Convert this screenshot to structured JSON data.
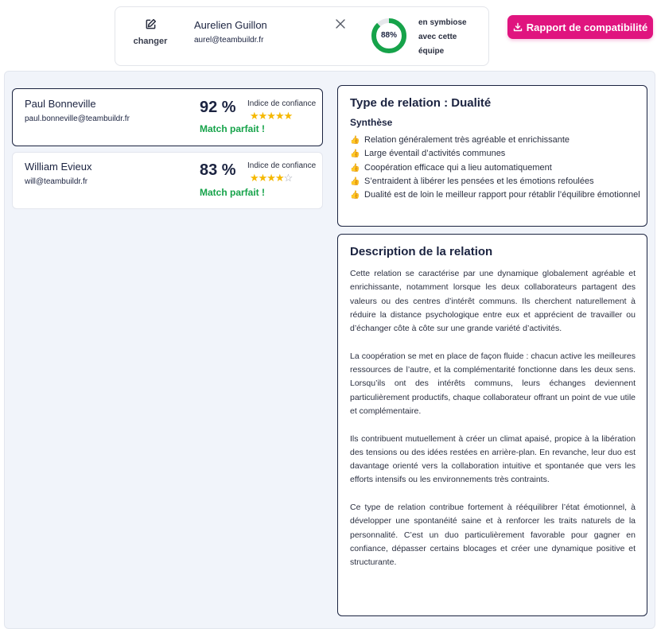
{
  "header": {
    "change_label": "changer",
    "person": {
      "name": "Aurelien Guillon",
      "email": "aurel@teambuildr.fr"
    },
    "gauge": {
      "value": 0.88,
      "label": "88%",
      "color": "#16a34a",
      "track_color": "#e5e7eb"
    },
    "symbiose_text": "en symbiose avec cette équipe",
    "report_button": {
      "label": "Rapport de compatibilité",
      "icon": "download-icon",
      "color": "#e0147f"
    }
  },
  "matches": [
    {
      "name": "Paul Bonneville",
      "email": "paul.bonneville@teambuildr.fr",
      "percent": "92 %",
      "confidence_label": "Indice de confiance",
      "stars": 5,
      "stars_text": "★★★★★",
      "match_label": "Match parfait !",
      "selected": true
    },
    {
      "name": "William Evieux",
      "email": "will@teambuildr.fr",
      "percent": "83 %",
      "confidence_label": "Indice de confiance",
      "stars": 4,
      "stars_on_text": "★★★★",
      "stars_off_text": "☆",
      "match_label": "Match parfait !",
      "selected": false
    }
  ],
  "relation": {
    "title_prefix": "Type de relation : ",
    "type": "Dualité",
    "synthesis_label": "Synthèse",
    "bullet_icon": "thumbs-up-icon",
    "bullet_glyph": "👍",
    "items": [
      "Relation généralement très agréable et enrichissante",
      "Large éventail d’activités communes",
      "Coopération efficace qui a lieu automatiquement",
      "S’entraident à libérer les pensées et les émotions refoulées",
      "Dualité est de loin le meilleur rapport pour rétablir l’équilibre émotionnel"
    ]
  },
  "description": {
    "title": "Description de la relation",
    "paragraphs": [
      "Cette relation se caractérise par une dynamique globalement agréable et enrichissante, notamment lorsque les deux collaborateurs partagent des valeurs ou des centres d’intérêt communs. Ils cherchent naturellement à réduire la distance psychologique entre eux et apprécient de travailler ou d’échanger côte à côte sur une grande variété d’activités.",
      "La coopération se met en place de façon fluide : chacun active les meilleures ressources de l’autre, et la complémentarité fonctionne dans les deux sens. Lorsqu’ils ont des intérêts communs, leurs échanges deviennent particulièrement productifs, chaque collaborateur offrant un point de vue utile et complémentaire.",
      "Ils contribuent mutuellement à créer un climat apaisé, propice à la libération des tensions ou des idées restées en arrière-plan. En revanche, leur duo est davantage orienté vers la collaboration intuitive et spontanée que vers les efforts intensifs ou les environnements très contraints.",
      "Ce type de relation contribue fortement à rééquilibrer l’état émotionnel, à développer une spontanéité saine et à renforcer les traits naturels de la personnalité. C’est un duo particulièrement favorable pour gagner en confiance, dépasser certains blocages et créer une dynamique positive et structurante."
    ]
  }
}
